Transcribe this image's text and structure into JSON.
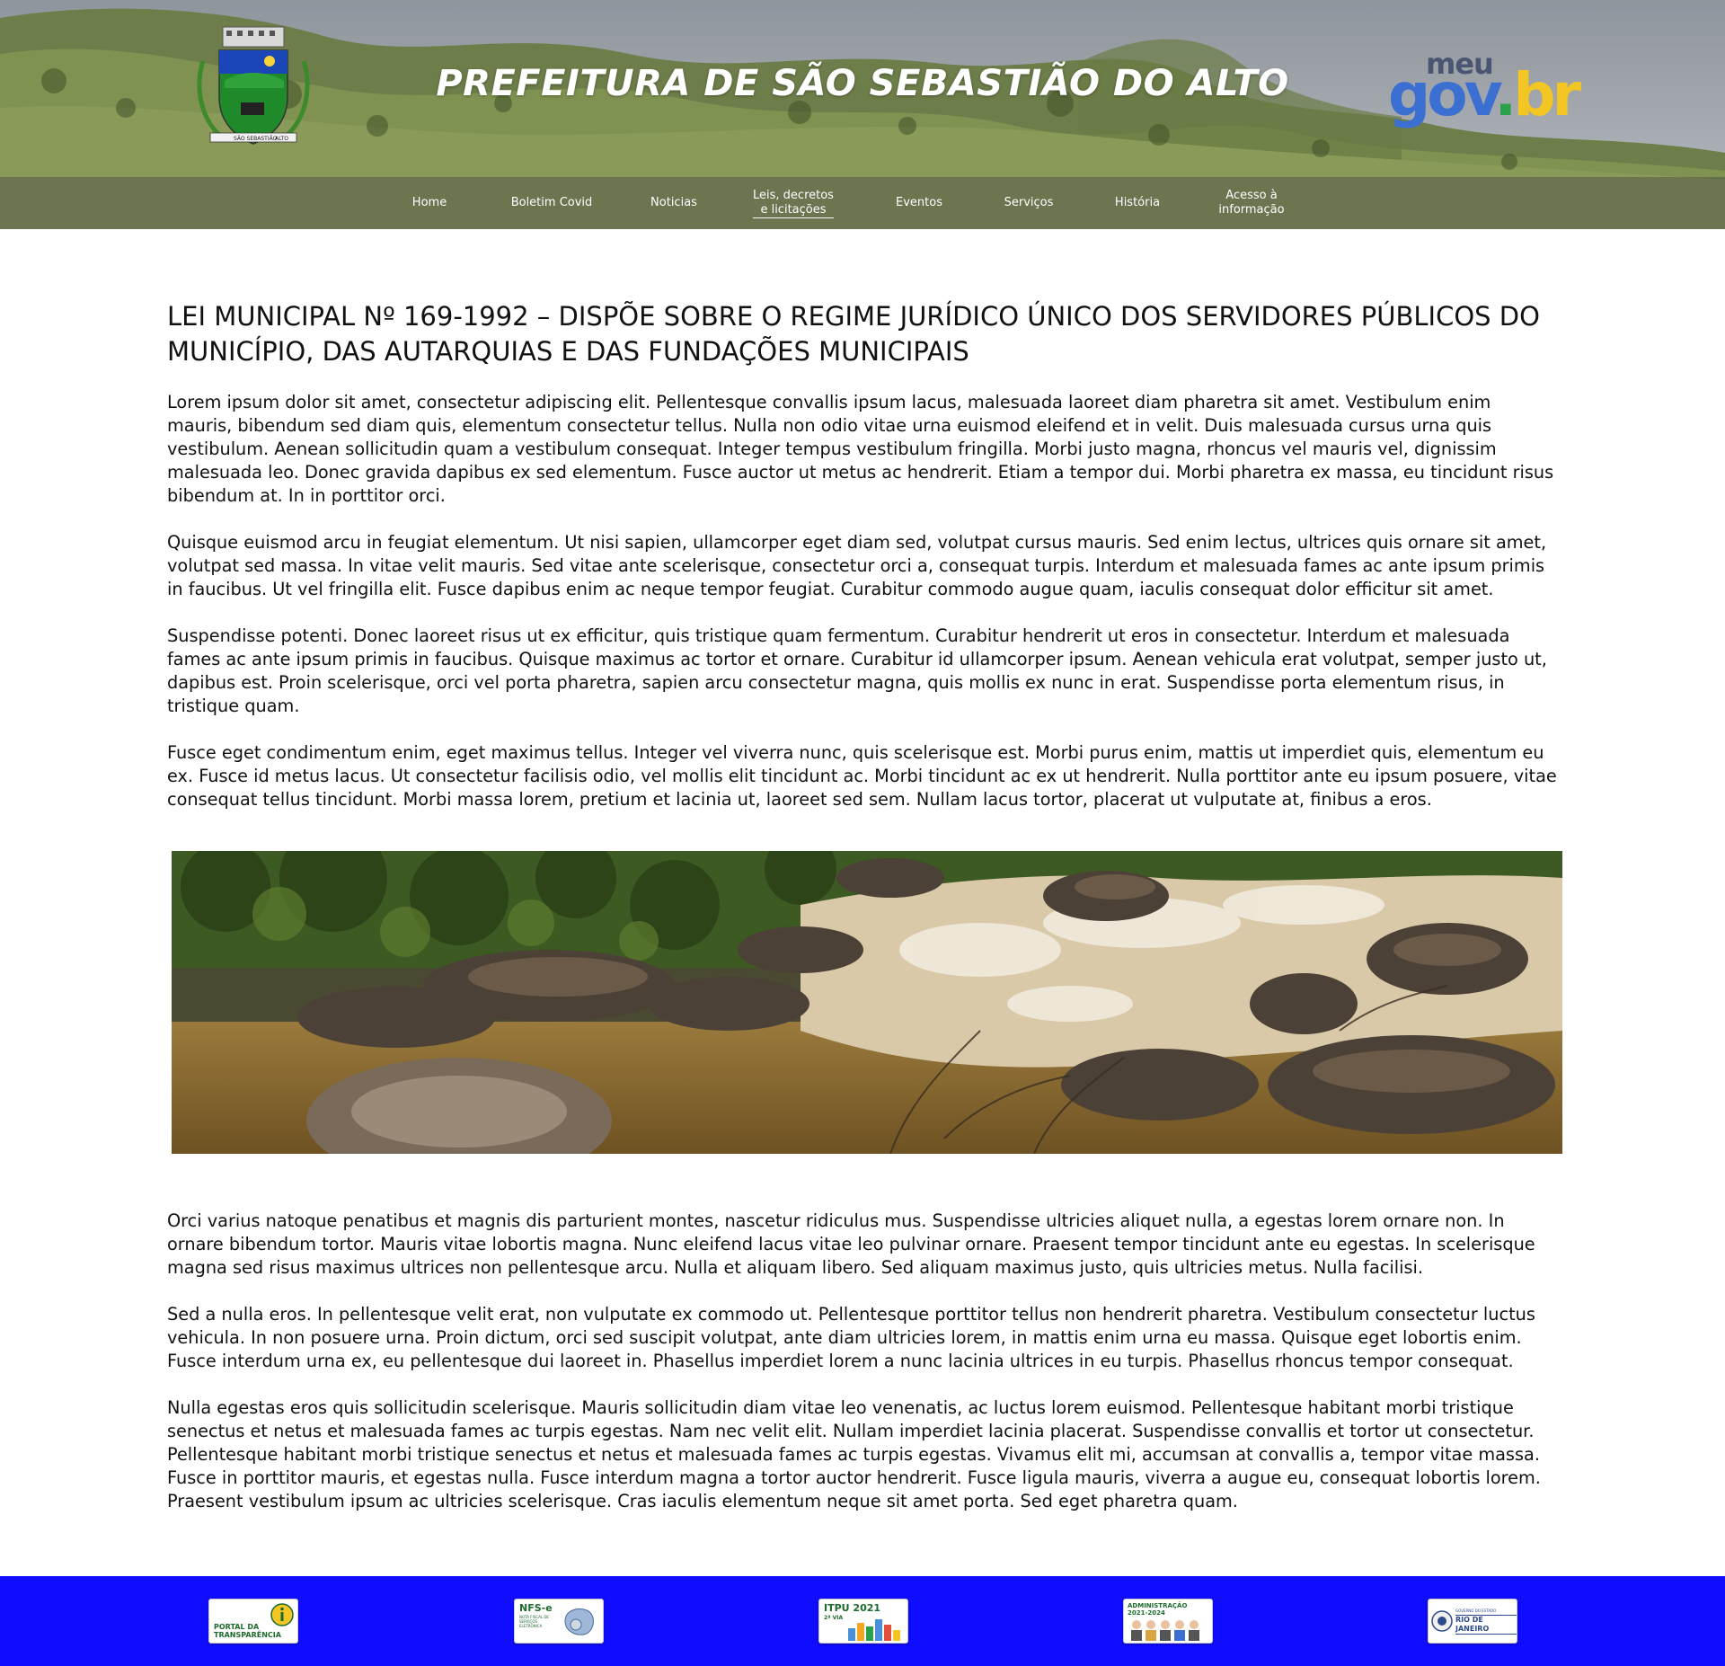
{
  "header": {
    "site_title": "PREFEITURA DE SÃO SEBASTIÃO DO ALTO",
    "crest_label_left": "SÃO SEBASTIÃO",
    "crest_label_right": "ALTO",
    "govbr_logo": {
      "meu": "meu",
      "gov": "gov",
      "dot": ".",
      "br": "br"
    }
  },
  "nav": {
    "items": [
      {
        "label": "Home",
        "active": false
      },
      {
        "label": "Boletim Covid",
        "active": false
      },
      {
        "label": "Noticias",
        "active": false
      },
      {
        "label": "Leis, decretos\ne licitações",
        "active": true
      },
      {
        "label": "Eventos",
        "active": false
      },
      {
        "label": "Serviços",
        "active": false
      },
      {
        "label": "História",
        "active": false
      },
      {
        "label": "Acesso à\ninformação",
        "active": false
      }
    ]
  },
  "article": {
    "title": "LEI MUNICIPAL Nº 169-1992 – DISPÕE SOBRE O REGIME JURÍDICO ÚNICO DOS SERVIDORES PÚBLICOS DO MUNICÍPIO, DAS AUTARQUIAS E DAS FUNDAÇÕES MUNICIPAIS",
    "paragraphs_top": [
      "Lorem ipsum dolor sit amet, consectetur adipiscing elit. Pellentesque convallis ipsum lacus, malesuada laoreet diam pharetra sit amet. Vestibulum enim mauris, bibendum sed diam quis, elementum consectetur tellus. Nulla non odio vitae urna euismod eleifend et in velit. Duis malesuada cursus urna quis vestibulum. Aenean sollicitudin quam a vestibulum consequat. Integer tempus vestibulum fringilla. Morbi justo magna, rhoncus vel mauris vel, dignissim malesuada leo. Donec gravida dapibus ex sed elementum. Fusce auctor ut metus ac hendrerit. Etiam a tempor dui. Morbi pharetra ex massa, eu tincidunt risus bibendum at. In in porttitor orci.",
      "Quisque euismod arcu in feugiat elementum. Ut nisi sapien, ullamcorper eget diam sed, volutpat cursus mauris. Sed enim lectus, ultrices quis ornare sit amet, volutpat sed massa. In vitae velit mauris. Sed vitae ante scelerisque, consectetur orci a, consequat turpis. Interdum et malesuada fames ac ante ipsum primis in faucibus. Ut vel fringilla elit. Fusce dapibus enim ac neque tempor feugiat. Curabitur commodo augue quam, iaculis consequat dolor efficitur sit amet.",
      "Suspendisse potenti. Donec laoreet risus ut ex efficitur, quis tristique quam fermentum. Curabitur hendrerit ut eros in consectetur. Interdum et malesuada fames ac ante ipsum primis in faucibus. Quisque maximus ac tortor et ornare. Curabitur id ullamcorper ipsum. Aenean vehicula erat volutpat, semper justo ut, dapibus est. Proin scelerisque, orci vel porta pharetra, sapien arcu consectetur magna, quis mollis ex nunc in erat. Suspendisse porta elementum risus, in tristique quam.",
      "Fusce eget condimentum enim, eget maximus tellus. Integer vel viverra nunc, quis scelerisque est. Morbi purus enim, mattis ut imperdiet quis, elementum eu ex. Fusce id metus lacus. Ut consectetur facilisis odio, vel mollis elit tincidunt ac. Morbi tincidunt ac ex ut hendrerit. Nulla porttitor ante eu ipsum posuere, vitae consequat tellus tincidunt. Morbi massa lorem, pretium et lacinia ut, laoreet sed sem. Nullam lacus tortor, placerat ut vulputate at, finibus a eros."
    ],
    "paragraphs_bottom": [
      "Orci varius natoque penatibus et magnis dis parturient montes, nascetur ridiculus mus. Suspendisse ultricies aliquet nulla, a egestas lorem ornare non. In ornare bibendum tortor. Mauris vitae lobortis magna. Nunc eleifend lacus vitae leo pulvinar ornare. Praesent tempor tincidunt ante eu egestas. In scelerisque magna sed risus maximus ultrices non pellentesque arcu. Nulla et aliquam libero. Sed aliquam maximus justo, quis ultricies metus. Nulla facilisi.",
      "Sed a nulla eros. In pellentesque velit erat, non vulputate ex commodo ut. Pellentesque porttitor tellus non hendrerit pharetra. Vestibulum consectetur luctus vehicula. In non posuere urna. Proin dictum, orci sed suscipit volutpat, ante diam ultricies lorem, in mattis enim urna eu massa. Quisque eget lobortis enim. Fusce interdum urna ex, eu pellentesque dui laoreet in. Phasellus imperdiet lorem a nunc lacinia ultrices in eu turpis. Phasellus rhoncus tempor consequat.",
      "Nulla egestas eros quis sollicitudin scelerisque. Mauris sollicitudin diam vitae leo venenatis, ac luctus lorem euismod. Pellentesque habitant morbi tristique senectus et netus et malesuada fames ac turpis egestas. Nam nec velit elit. Nullam imperdiet lacinia placerat. Suspendisse convallis et tortor ut consectetur. Pellentesque habitant morbi tristique senectus et netus et malesuada fames ac turpis egestas. Vivamus elit mi, accumsan at convallis a, tempor vitae massa. Fusce in porttitor mauris, et egestas nulla. Fusce interdum magna a tortor auctor hendrerit. Fusce ligula mauris, viverra a augue eu, consequat lobortis lorem. Praesent vestibulum ipsum ac ultricies scelerisque. Cras iaculis elementum neque sit amet porta. Sed eget pharetra quam."
    ]
  },
  "footer": {
    "badges": [
      {
        "line1": "PORTAL DA",
        "line2": "TRANSPARÊNCIA",
        "icon": "info-icon"
      },
      {
        "line1": "NFS-e",
        "line2": "NOTA FISCAL DE SERVIÇOS ELETRÔNICA",
        "icon": "map-icon"
      },
      {
        "line1": "ITPU 2021",
        "line2": "2ª VIA",
        "icon": "buildings-icon"
      },
      {
        "line1": "ADMINISTRAÇÃO",
        "line2": "2021-2024",
        "icon": "people-icon"
      },
      {
        "line1": "GOVERNO DO ESTADO",
        "line2": "RIO DE JANEIRO",
        "icon": "state-seal-icon"
      }
    ]
  },
  "colors": {
    "footer_bg": "#0f0cff",
    "nav_bg": "rgba(70,70,70,0.45)",
    "govbr_blue": "#3b6fd1",
    "govbr_yellow": "#f3c623",
    "govbr_green": "#2aa04a"
  }
}
